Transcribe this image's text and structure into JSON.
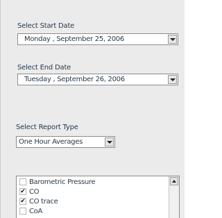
{
  "start_date": {
    "label": "Select Start Date",
    "value": "Monday   , September 25, 2006"
  },
  "end_date": {
    "label": "Select End Date",
    "value": "Tuesday   , September 26, 2006"
  },
  "report_type": {
    "label": "Select Report Type",
    "value": "One Hour Averages"
  },
  "parameters": [
    {
      "label": "Barometric Pressure",
      "checked": false
    },
    {
      "label": "CO",
      "checked": true
    },
    {
      "label": "CO trace",
      "checked": true
    },
    {
      "label": "CoA",
      "checked": false
    }
  ],
  "icons": {
    "dropdown": "chevron-down-icon",
    "scroll_up": "arrow-up-icon",
    "check": "checkmark-icon"
  },
  "colors": {
    "panel_bg": "#ebebeb",
    "border": "#8c8c8c",
    "text": "#2a3a4a"
  }
}
